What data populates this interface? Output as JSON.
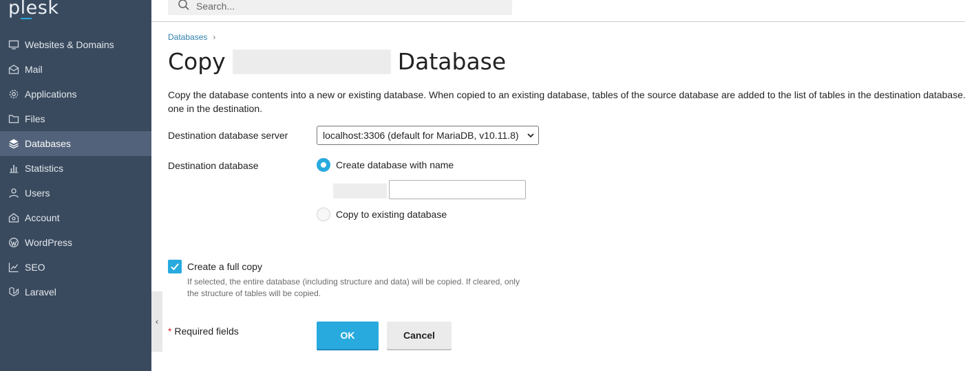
{
  "app": {
    "logo_text": "plesk",
    "accent_color": "#28aade",
    "sidebar_color": "#3a4a5e"
  },
  "search": {
    "placeholder": "Search..."
  },
  "sidebar": {
    "items": [
      {
        "label": "Websites & Domains",
        "icon": "monitor-icon",
        "active": false
      },
      {
        "label": "Mail",
        "icon": "mail-icon",
        "active": false
      },
      {
        "label": "Applications",
        "icon": "gear-icon",
        "active": false
      },
      {
        "label": "Files",
        "icon": "folder-icon",
        "active": false
      },
      {
        "label": "Databases",
        "icon": "layers-icon",
        "active": true
      },
      {
        "label": "Statistics",
        "icon": "bar-chart-icon",
        "active": false
      },
      {
        "label": "Users",
        "icon": "user-icon",
        "active": false
      },
      {
        "label": "Account",
        "icon": "account-icon",
        "active": false
      },
      {
        "label": "WordPress",
        "icon": "wordpress-icon",
        "active": false
      },
      {
        "label": "SEO",
        "icon": "seo-chart-icon",
        "active": false
      },
      {
        "label": "Laravel",
        "icon": "laravel-icon",
        "active": false
      }
    ]
  },
  "breadcrumb": {
    "databases": "Databases"
  },
  "page": {
    "title_prefix": "Copy",
    "title_suffix": "Database",
    "description": "Copy the database contents into a new or existing database. When copied to an existing database, tables of the source database are added to the list of tables in the destination database. one in the destination."
  },
  "form": {
    "server_label": "Destination database server",
    "server_value": "localhost:3306 (default for MariaDB, v10.11.8)",
    "dest_label": "Destination database",
    "option_create": "Create database with name",
    "option_existing": "Copy to existing database",
    "create_selected": true,
    "name_value": "",
    "full_copy_label": "Create a full copy",
    "full_copy_checked": true,
    "full_copy_hint": "If selected, the entire database (including structure and data) will be copied. If cleared, only the structure of tables will be copied.",
    "required_mark": "*",
    "required_text": "Required fields"
  },
  "buttons": {
    "ok": "OK",
    "cancel": "Cancel"
  }
}
